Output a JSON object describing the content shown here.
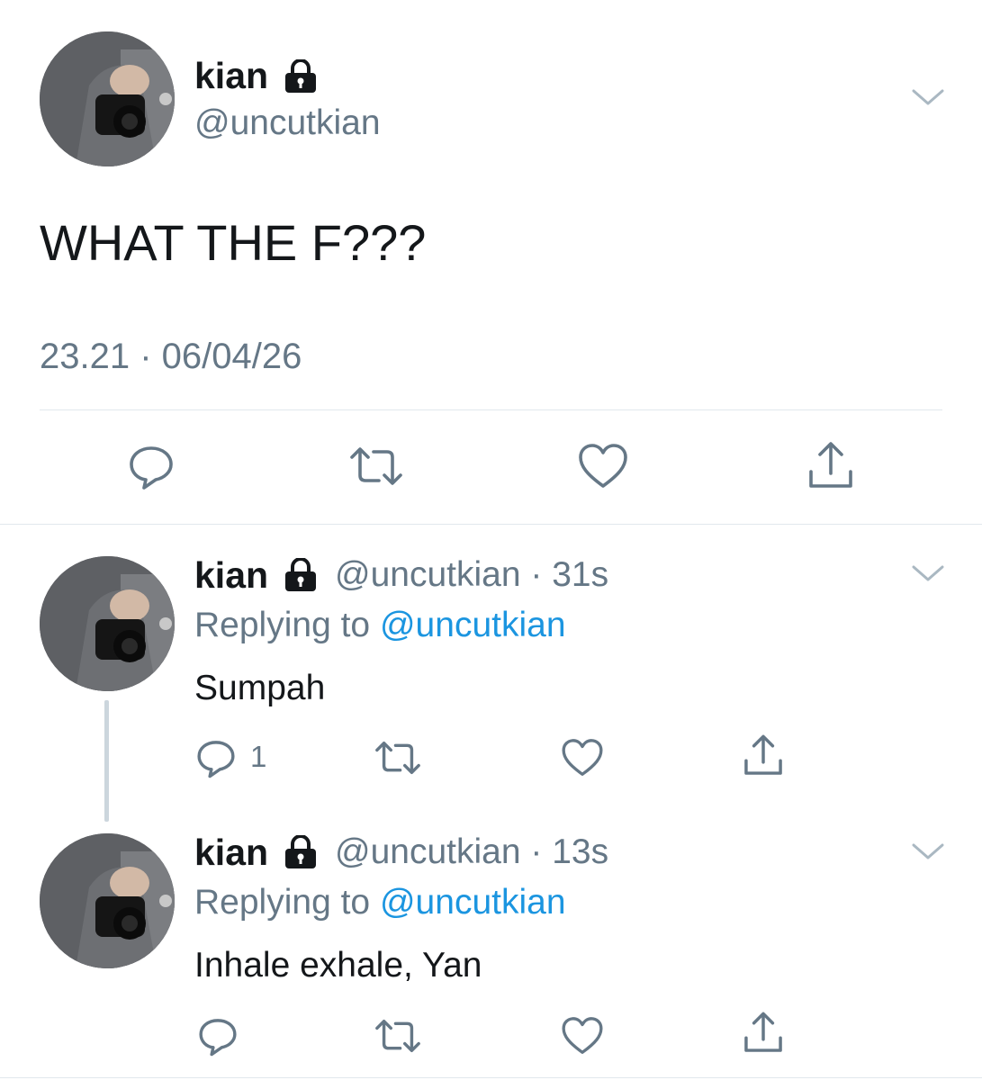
{
  "main_tweet": {
    "display_name": "kian",
    "handle": "@uncutkian",
    "text": "WHAT THE F???",
    "timestamp": "23.21 · 06/04/26"
  },
  "replies": [
    {
      "display_name": "kian",
      "handle_time": "@uncutkian · 31s",
      "replying_prefix": "Replying to",
      "replying_handle": "@uncutkian",
      "text": "Sumpah",
      "reply_count": "1"
    },
    {
      "display_name": "kian",
      "handle_time": "@uncutkian · 13s",
      "replying_prefix": "Replying to",
      "replying_handle": "@uncutkian",
      "text": "Inhale exhale, Yan",
      "reply_count": ""
    }
  ],
  "icons": {
    "lock": "lock-icon",
    "menu": "chevron-down-icon",
    "reply": "reply-icon",
    "retweet": "retweet-icon",
    "like": "heart-icon",
    "share": "share-icon"
  },
  "colors": {
    "text": "#14171a",
    "secondary": "#657786",
    "link": "#1b95e0",
    "divider": "#e1e8ed",
    "thread_line": "#ccd6dd"
  }
}
